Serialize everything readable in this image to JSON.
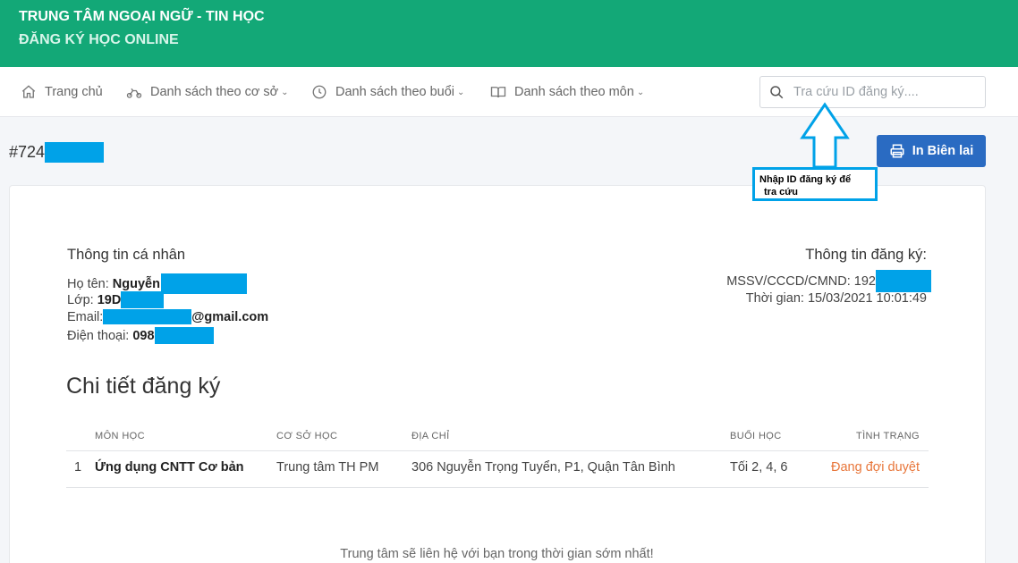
{
  "header": {
    "title": "TRUNG TÂM NGOẠI NGỮ - TIN HỌC",
    "subtitle": "ĐĂNG KÝ HỌC ONLINE"
  },
  "nav": {
    "items": [
      {
        "label": "Trang chủ",
        "icon": "home-icon",
        "dropdown": false
      },
      {
        "label": "Danh sách theo cơ sở",
        "icon": "bike-icon",
        "dropdown": true
      },
      {
        "label": "Danh sách theo buổi",
        "icon": "clock-icon",
        "dropdown": true
      },
      {
        "label": "Danh sách theo môn",
        "icon": "book-icon",
        "dropdown": true
      }
    ],
    "search_placeholder": "Tra cứu ID đăng ký...."
  },
  "registration": {
    "id_prefix": "#724",
    "print_label": "In Biên lai"
  },
  "annotation": {
    "line1": "Nhập ID  đăng ký   để",
    "line2": "tra cứu",
    "color": "#00a2e8"
  },
  "personal": {
    "heading": "Thông tin cá nhân",
    "name_label": "Họ tên:",
    "name_value": "Nguyễn",
    "class_label": "Lớp:",
    "class_value": "19D",
    "email_label": "Email:",
    "email_suffix": "@gmail.com",
    "phone_label": "Điện thoại:",
    "phone_value": "098"
  },
  "reg_info": {
    "heading": "Thông tin đăng ký:",
    "id_label": "MSSV/CCCD/CMND: 192",
    "time_label": "Thời gian: 15/03/2021 10:01:49"
  },
  "details": {
    "title": "Chi tiết đăng ký",
    "columns": [
      "MÔN HỌC",
      "CƠ SỞ HỌC",
      "ĐỊA CHỈ",
      "BUỔI HỌC",
      "TÌNH TRẠNG"
    ],
    "rows": [
      {
        "index": "1",
        "subject": "Ứng dụng CNTT Cơ bản",
        "campus": "Trung tâm TH PM",
        "address": "306 Nguyễn Trọng Tuyển, P1, Quận Tân Bình",
        "sessions": "Tối 2, 4, 6",
        "status": "Đang đợi duyệt"
      }
    ],
    "status_color": "#e8763a"
  },
  "footer_note": "Trung tâm sẽ liên hệ với bạn trong thời gian sớm nhất!",
  "colors": {
    "header_bg": "#13a877",
    "button_bg": "#2a6bc2",
    "redaction": "#00a2e8"
  }
}
